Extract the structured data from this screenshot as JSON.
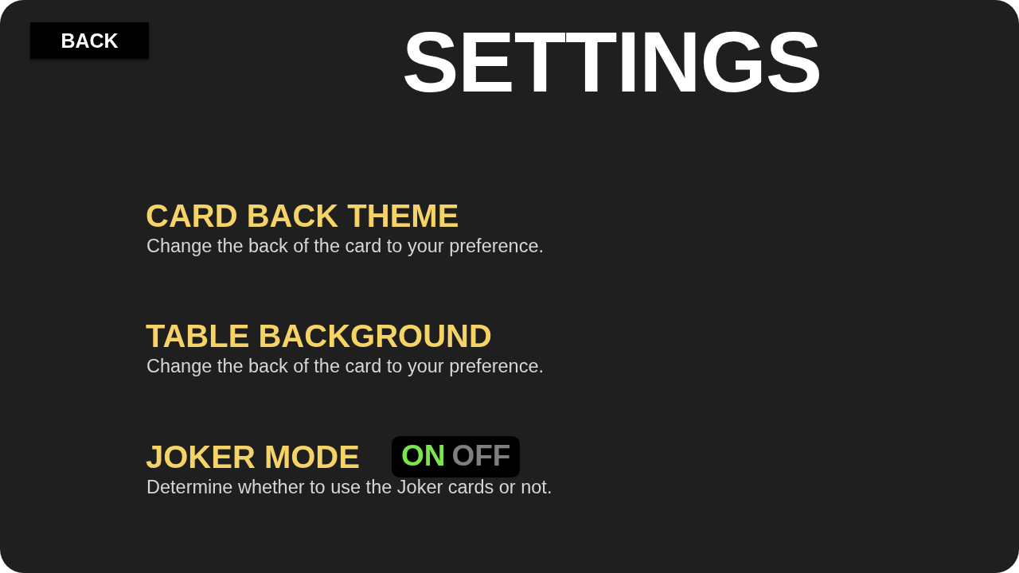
{
  "back_button": {
    "label": "BACK"
  },
  "title": "SETTINGS",
  "settings": [
    {
      "kind": "option",
      "title": "CARD BACK THEME",
      "description": "Change the back of the card to your preference."
    },
    {
      "kind": "option",
      "title": "TABLE BACKGROUND",
      "description": "Change the back of the card to your preference."
    },
    {
      "kind": "toggle",
      "title": "JOKER MODE",
      "description": "Determine whether to use the Joker cards or not.",
      "toggle": [
        {
          "label": "ON",
          "selected": true
        },
        {
          "label": "OFF",
          "selected": false
        }
      ]
    }
  ]
}
